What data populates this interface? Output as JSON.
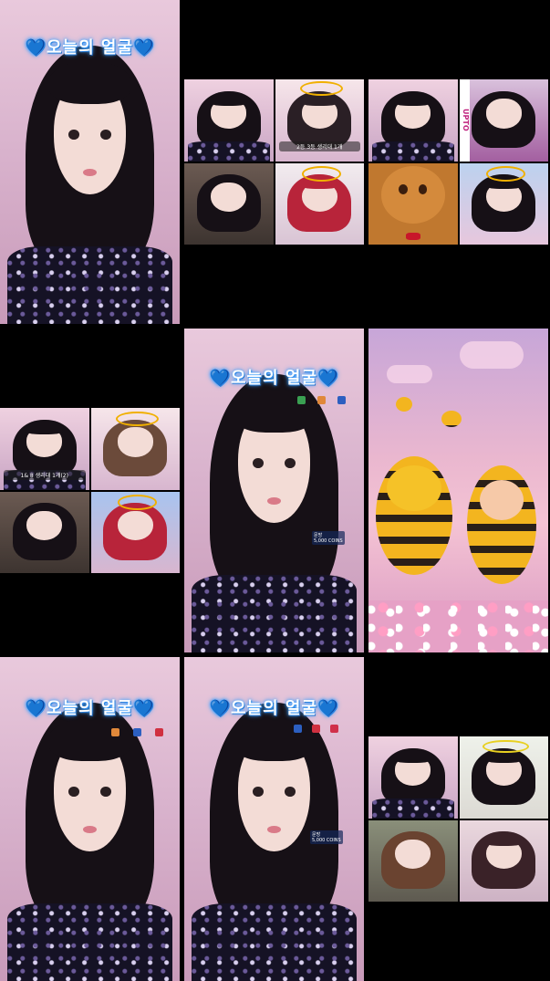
{
  "banner": {
    "text": "오늘의 얼굴",
    "heart": "💙"
  },
  "captions": {
    "top_grid_a": "2등 3등 생리대 1개",
    "mid_grid": "1& 8 생리대 1개(2)",
    "side_vertical": "UPTO",
    "small_label": "문방",
    "small_value": "5,000 COINS"
  },
  "icons": [
    "heart-icon",
    "gift-icon",
    "fox-icon",
    "flower-icon"
  ],
  "colors": {
    "background": "#000000",
    "banner_glow": "#3aa0ff",
    "pink_bg": "#d9b3cd"
  }
}
